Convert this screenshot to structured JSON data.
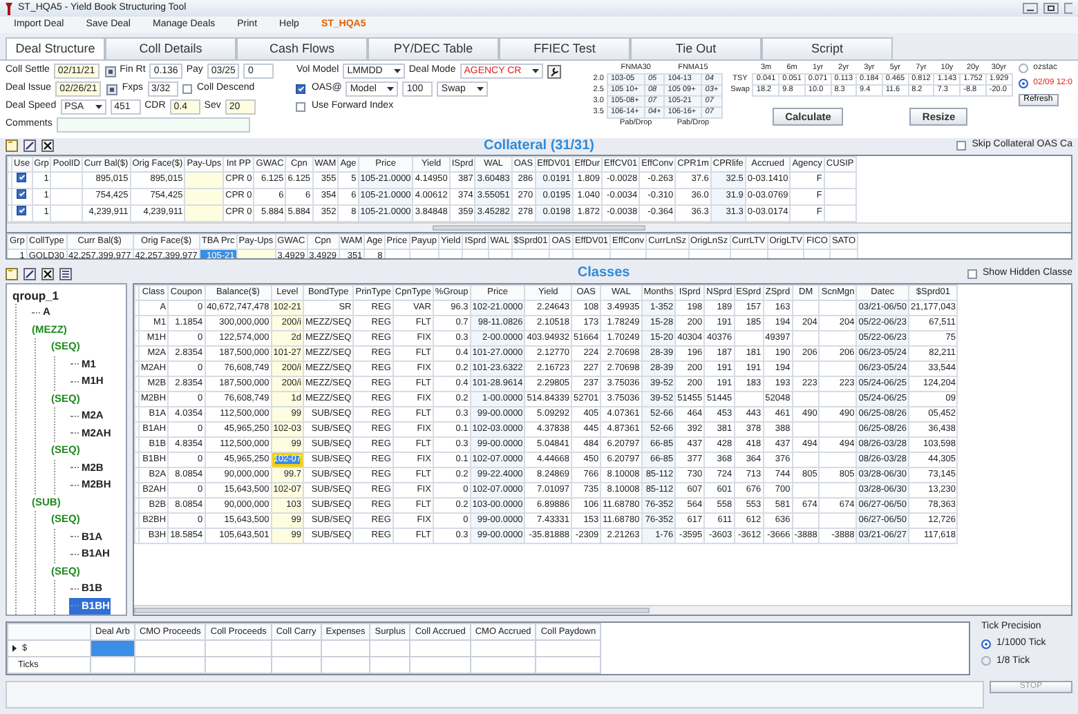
{
  "window": {
    "title": "ST_HQA5 - Yield Book Structuring Tool"
  },
  "menu": [
    {
      "label": "Import Deal",
      "kind": "item"
    },
    {
      "label": "Save Deal",
      "kind": "item"
    },
    {
      "label": "Manage Deals",
      "kind": "item"
    },
    {
      "label": "Print",
      "kind": "item"
    },
    {
      "label": "Help",
      "kind": "item"
    },
    {
      "label": "ST_HQA5",
      "kind": "deal"
    }
  ],
  "tabs": [
    {
      "label": "Deal Structure",
      "selected": true
    },
    {
      "label": "Coll Details",
      "selected": false
    },
    {
      "label": "Cash Flows",
      "selected": false
    },
    {
      "label": "PY/DEC Table",
      "selected": false
    },
    {
      "label": "FFIEC Test",
      "selected": false
    },
    {
      "label": "Tie Out",
      "selected": false
    },
    {
      "label": "Script",
      "selected": false
    }
  ],
  "form": {
    "left": [
      [
        {
          "kind": "label",
          "text": "Coll Settle"
        },
        {
          "kind": "date",
          "value": "02/11/21",
          "highlighted": true
        },
        {
          "kind": "label",
          "text": "Fin Rt"
        },
        {
          "kind": "input",
          "value": "0.136",
          "highlighted": false
        },
        {
          "kind": "label",
          "text": "Pay"
        },
        {
          "kind": "input",
          "value": "03/25",
          "highlighted": false
        },
        {
          "kind": "input",
          "value": "0",
          "highlighted": false
        }
      ],
      [
        {
          "kind": "label",
          "text": "Deal Issue"
        },
        {
          "kind": "date",
          "value": "02/26/21",
          "highlighted": true
        },
        {
          "kind": "label",
          "text": "Fxps"
        },
        {
          "kind": "input",
          "value": "3/32",
          "highlighted": false
        },
        {
          "kind": "checkbox",
          "label": "Coll Descend",
          "checked": false
        }
      ],
      [
        {
          "kind": "label",
          "text": "Deal Speed"
        },
        {
          "kind": "select",
          "value": "PSA"
        },
        {
          "kind": "input",
          "value": "451",
          "highlighted": false
        },
        {
          "kind": "label",
          "text": "CDR"
        },
        {
          "kind": "input",
          "value": "0.4",
          "highlighted": true
        },
        {
          "kind": "label",
          "text": "Sev"
        },
        {
          "kind": "input",
          "value": "20",
          "highlighted": true
        }
      ],
      [
        {
          "kind": "label",
          "text": "Comments"
        },
        {
          "kind": "wide"
        }
      ]
    ],
    "right": [
      [
        {
          "kind": "label",
          "text": "Vol Model"
        },
        {
          "kind": "select",
          "value": "LMMDD"
        },
        {
          "kind": "label",
          "text": "Deal Mode"
        },
        {
          "kind": "select",
          "value": "AGENCY CR",
          "color": "#e02020"
        },
        {
          "kind": "tool"
        }
      ],
      [
        {
          "kind": "checkbox",
          "label": "OAS@",
          "checked": true
        },
        {
          "kind": "select",
          "value": "Model"
        },
        {
          "kind": "input",
          "value": "100",
          "highlighted": false
        },
        {
          "kind": "select",
          "value": "Swap"
        }
      ],
      [
        {
          "kind": "checkbox",
          "label": "Use Forward Index",
          "checked": false
        }
      ]
    ]
  },
  "prices": {
    "columns": [
      "FNMA30",
      "FNMA15"
    ],
    "rows": [
      {
        "coupon": "2.0",
        "cells": [
          {
            "price": "103-05",
            "drop": "05"
          },
          {
            "price": "104-13",
            "drop": "04"
          }
        ]
      },
      {
        "coupon": "2.5",
        "cells": [
          {
            "price": "105 10+",
            "drop": "08"
          },
          {
            "price": "105 09+",
            "drop": "03+"
          }
        ]
      },
      {
        "coupon": "3.0",
        "cells": [
          {
            "price": "105-08+",
            "drop": "07"
          },
          {
            "price": "105-21",
            "drop": "07"
          }
        ]
      },
      {
        "coupon": "3.5",
        "cells": [
          {
            "price": "106-14+",
            "drop": "04+"
          },
          {
            "price": "106-16+",
            "drop": "07"
          }
        ]
      }
    ],
    "footer": [
      "Pab/Drop",
      "Pab/Drop"
    ]
  },
  "rates": {
    "columns": [
      "3m",
      "6m",
      "1yr",
      "2yr",
      "3yr",
      "5yr",
      "7yr",
      "10y",
      "20y",
      "30yr"
    ],
    "rows": [
      {
        "label": "TSY",
        "values": [
          "0.041",
          "0.051",
          "0.071",
          "0.113",
          "0.184",
          "0.465",
          "0.812",
          "1.143",
          "1.752",
          "1.929"
        ]
      },
      {
        "label": "Swap",
        "values": [
          "18.2",
          "9.8",
          "10.0",
          "8.3",
          "9.4",
          "11.6",
          "8.2",
          "7.3",
          "-8.8",
          "-20.0"
        ]
      }
    ]
  },
  "sources": [
    {
      "label": "ozstac",
      "selected": false,
      "color": "#333333"
    },
    {
      "label": "02/09 12:0",
      "selected": true,
      "color": "#e02020"
    }
  ],
  "buttons": {
    "refresh": "Refresh",
    "calculate": "Calculate",
    "resize": "Resize",
    "stop": "STOP"
  },
  "collateral": {
    "title": "Collateral (31/31)",
    "skip": {
      "label": "Skip Collateral OAS Ca",
      "checked": false
    },
    "use_label": "Use",
    "columns": [
      {
        "label": "Grp",
        "editable": false
      },
      {
        "label": "PoolID",
        "editable": false
      },
      {
        "label": "Curr Bal($)",
        "editable": false
      },
      {
        "label": "Orig Face($)",
        "editable": false
      },
      {
        "label": "Pay-Ups",
        "editable": true
      },
      {
        "label": "Int PP",
        "editable": false
      },
      {
        "label": "GWAC",
        "editable": false
      },
      {
        "label": "Cpn",
        "editable": false
      },
      {
        "label": "WAM",
        "editable": false
      },
      {
        "label": "Age",
        "editable": false
      },
      {
        "label": "Price",
        "editable": false
      },
      {
        "label": "Yield",
        "editable": false
      },
      {
        "label": "ISprd",
        "editable": false
      },
      {
        "label": "WAL",
        "editable": false
      },
      {
        "label": "OAS",
        "editable": false
      },
      {
        "label": "EffDV01",
        "editable": false
      },
      {
        "label": "EffDur",
        "editable": false
      },
      {
        "label": "EffCV01",
        "editable": false
      },
      {
        "label": "EffConv",
        "editable": false
      },
      {
        "label": "CPR1m",
        "editable": false
      },
      {
        "label": "CPRlife",
        "editable": false
      },
      {
        "label": "Accrued",
        "editable": false
      },
      {
        "label": "Agency",
        "editable": false
      },
      {
        "label": "CUSIP",
        "editable": false
      }
    ],
    "rows": [
      {
        "use": true,
        "cells": [
          "1",
          "",
          "895,015",
          "895,015",
          "",
          "CPR 0",
          "6.125",
          "6.125",
          "355",
          "5",
          "105-21.0000",
          "4.14950",
          "387",
          "3.60483",
          "286",
          "0.0191",
          "1.809",
          "-0.0028",
          "-0.263",
          "37.6",
          "32.5",
          "0-03.1410",
          "F",
          ""
        ]
      },
      {
        "use": true,
        "cells": [
          "1",
          "",
          "754,425",
          "754,425",
          "",
          "CPR 0",
          "6",
          "6",
          "354",
          "6",
          "105-21.0000",
          "4.00612",
          "374",
          "3.55051",
          "270",
          "0.0195",
          "1.040",
          "-0.0034",
          "-0.310",
          "36.0",
          "31.9",
          "0-03.0769",
          "F",
          ""
        ]
      },
      {
        "use": true,
        "cells": [
          "1",
          "",
          "4,239,911",
          "4,239,911",
          "",
          "CPR 0",
          "5.884",
          "5.884",
          "352",
          "8",
          "105-21.0000",
          "3.84848",
          "359",
          "3.45282",
          "278",
          "0.0198",
          "1.872",
          "-0.0038",
          "-0.364",
          "36.3",
          "31.3",
          "0-03.0174",
          "F",
          ""
        ]
      }
    ]
  },
  "summary": {
    "columns": [
      {
        "label": "Grp",
        "editable": false
      },
      {
        "label": "CollType",
        "editable": false
      },
      {
        "label": "Curr Bal($)",
        "editable": false
      },
      {
        "label": "Orig Face($)",
        "editable": false
      },
      {
        "label": "TBA Prc",
        "editable": false
      },
      {
        "label": "Pay-Ups",
        "editable": true
      },
      {
        "label": "GWAC",
        "editable": false
      },
      {
        "label": "Cpn",
        "editable": false
      },
      {
        "label": "WAM",
        "editable": false
      },
      {
        "label": "Age",
        "editable": false
      },
      {
        "label": "Price",
        "editable": false
      },
      {
        "label": "Payup",
        "editable": false
      },
      {
        "label": "Yield",
        "editable": false
      },
      {
        "label": "ISprd",
        "editable": false
      },
      {
        "label": "WAL",
        "editable": false
      },
      {
        "label": "$Sprd01",
        "editable": false
      },
      {
        "label": "OAS",
        "editable": false
      },
      {
        "label": "EffDV01",
        "editable": false
      },
      {
        "label": "EffConv",
        "editable": false
      },
      {
        "label": "CurrLnSz",
        "editable": false
      },
      {
        "label": "OrigLnSz",
        "editable": false
      },
      {
        "label": "CurrLTV",
        "editable": false
      },
      {
        "label": "OrigLTV",
        "editable": false
      },
      {
        "label": "FICO",
        "editable": false
      },
      {
        "label": "SATO",
        "editable": false
      }
    ],
    "rows": [
      {
        "selected": true,
        "cells": [
          "1",
          "GOLD30",
          "42,257,399,977",
          "42,257,399,977",
          "105-21",
          "",
          "3.4929",
          "3.4929",
          "351",
          "8",
          "",
          "",
          "",
          "",
          "",
          "",
          "",
          "",
          "",
          "",
          "",
          "",
          "",
          "",
          ""
        ]
      }
    ]
  },
  "classes": {
    "title": "Classes",
    "show_hidden": {
      "label": "Show Hidden Classe",
      "checked": false
    },
    "tree": {
      "label": "qroup_1",
      "kind": "root",
      "children": [
        {
          "label": "A",
          "kind": "class"
        },
        {
          "label": "(MEZZ)",
          "kind": "group",
          "children": [
            {
              "label": "(SEQ)",
              "kind": "group",
              "children": [
                {
                  "label": "M1",
                  "kind": "class"
                },
                {
                  "label": "M1H",
                  "kind": "class"
                }
              ]
            },
            {
              "label": "(SEQ)",
              "kind": "group",
              "children": [
                {
                  "label": "M2A",
                  "kind": "class"
                },
                {
                  "label": "M2AH",
                  "kind": "class"
                }
              ]
            },
            {
              "label": "(SEQ)",
              "kind": "group",
              "children": [
                {
                  "label": "M2B",
                  "kind": "class"
                },
                {
                  "label": "M2BH",
                  "kind": "class"
                }
              ]
            }
          ]
        },
        {
          "label": "(SUB)",
          "kind": "group",
          "children": [
            {
              "label": "(SEQ)",
              "kind": "group",
              "children": [
                {
                  "label": "B1A",
                  "kind": "class"
                },
                {
                  "label": "B1AH",
                  "kind": "class"
                }
              ]
            },
            {
              "label": "(SEQ)",
              "kind": "group",
              "children": [
                {
                  "label": "B1B",
                  "kind": "class"
                },
                {
                  "label": "B1BH",
                  "kind": "class",
                  "selected": true
                }
              ]
            }
          ]
        }
      ]
    },
    "columns": [
      {
        "label": "Class",
        "editable": false
      },
      {
        "label": "Coupon",
        "editable": false
      },
      {
        "label": "Balance($)",
        "editable": false
      },
      {
        "label": "Level",
        "editable": true
      },
      {
        "label": "BondType",
        "editable": false
      },
      {
        "label": "PrinType",
        "editable": false
      },
      {
        "label": "CpnType",
        "editable": false
      },
      {
        "label": "%Group",
        "editable": false
      },
      {
        "label": "Price",
        "editable": false
      },
      {
        "label": "Yield",
        "editable": false
      },
      {
        "label": "OAS",
        "editable": false
      },
      {
        "label": "WAL",
        "editable": false
      },
      {
        "label": "Months",
        "editable": false
      },
      {
        "label": "ISprd",
        "editable": false
      },
      {
        "label": "NSprd",
        "editable": false
      },
      {
        "label": "ESprd",
        "editable": false
      },
      {
        "label": "ZSprd",
        "editable": false
      },
      {
        "label": "DM",
        "editable": false
      },
      {
        "label": "ScnMgn",
        "editable": false
      },
      {
        "label": "Datec",
        "editable": false
      },
      {
        "label": "$Sprd01",
        "editable": false
      }
    ],
    "rows": [
      {
        "selected": false,
        "cells": [
          "A",
          "0",
          "40,672,747,478",
          "102-21",
          "SR",
          "REG",
          "VAR",
          "96.3",
          "102-21.0000",
          "2.24643",
          "108",
          "3.49935",
          "1-352",
          "198",
          "189",
          "157",
          "163",
          "",
          "",
          "03/21-06/50",
          "21,177,043"
        ]
      },
      {
        "selected": false,
        "cells": [
          "M1",
          "1.1854",
          "300,000,000",
          "200/i",
          "MEZZ/SEQ",
          "REG",
          "FLT",
          "0.7",
          "98-11.0826",
          "2.10518",
          "173",
          "1.78249",
          "15-28",
          "200",
          "191",
          "185",
          "194",
          "204",
          "204",
          "05/22-06/23",
          "67,511"
        ]
      },
      {
        "selected": false,
        "cells": [
          "M1H",
          "0",
          "122,574,000",
          "2d",
          "MEZZ/SEQ",
          "REG",
          "FIX",
          "0.3",
          "2-00.0000",
          "403.94932",
          "51664",
          "1.70249",
          "15-20",
          "40304",
          "40376",
          "",
          "49397",
          "",
          "",
          "05/22-06/23",
          "75"
        ]
      },
      {
        "selected": false,
        "cells": [
          "M2A",
          "2.8354",
          "187,500,000",
          "101-27",
          "MEZZ/SEQ",
          "REG",
          "FLT",
          "0.4",
          "101-27.0000",
          "2.12770",
          "224",
          "2.70698",
          "28-39",
          "196",
          "187",
          "181",
          "190",
          "206",
          "206",
          "06/23-05/24",
          "82,211"
        ]
      },
      {
        "selected": false,
        "cells": [
          "M2AH",
          "0",
          "76,608,749",
          "200/i",
          "MEZZ/SEQ",
          "REG",
          "FIX",
          "0.2",
          "101-23.6322",
          "2.16723",
          "227",
          "2.70698",
          "28-39",
          "200",
          "191",
          "191",
          "194",
          "",
          "",
          "06/23-05/24",
          "33,544"
        ]
      },
      {
        "selected": false,
        "cells": [
          "M2B",
          "2.8354",
          "187,500,000",
          "200/i",
          "MEZZ/SEQ",
          "REG",
          "FLT",
          "0.4",
          "101-28.9614",
          "2.29805",
          "237",
          "3.75036",
          "39-52",
          "200",
          "191",
          "183",
          "193",
          "223",
          "223",
          "05/24-06/25",
          "124,204"
        ]
      },
      {
        "selected": false,
        "cells": [
          "M2BH",
          "0",
          "76,608,749",
          "1d",
          "MEZZ/SEQ",
          "REG",
          "FIX",
          "0.2",
          "1-00.0000",
          "514.84339",
          "52701",
          "3.75036",
          "39-52",
          "51455",
          "51445",
          "",
          "52048",
          "",
          "",
          "05/24-06/25",
          "09"
        ]
      },
      {
        "selected": false,
        "cells": [
          "B1A",
          "4.0354",
          "112,500,000",
          "99",
          "SUB/SEQ",
          "REG",
          "FLT",
          "0.3",
          "99-00.0000",
          "5.09292",
          "405",
          "4.07361",
          "52-66",
          "464",
          "453",
          "443",
          "461",
          "490",
          "490",
          "06/25-08/26",
          "05,452"
        ]
      },
      {
        "selected": false,
        "cells": [
          "B1AH",
          "0",
          "45,965,250",
          "102-03",
          "SUB/SEQ",
          "REG",
          "FIX",
          "0.1",
          "102-03.0000",
          "4.37838",
          "445",
          "4.87361",
          "52-66",
          "392",
          "381",
          "378",
          "388",
          "",
          "",
          "06/25-08/26",
          "36,438"
        ]
      },
      {
        "selected": false,
        "cells": [
          "B1B",
          "4.8354",
          "112,500,000",
          "99",
          "SUB/SEQ",
          "REG",
          "FLT",
          "0.3",
          "99-00.0000",
          "5.04841",
          "484",
          "6.20797",
          "66-85",
          "437",
          "428",
          "418",
          "437",
          "494",
          "494",
          "08/26-03/28",
          "103,598"
        ]
      },
      {
        "selected": true,
        "cells": [
          "B1BH",
          "0",
          "45,965,250",
          "102-07",
          "SUB/SEQ",
          "REG",
          "FIX",
          "0.1",
          "102-07.0000",
          "4.44668",
          "450",
          "6.20797",
          "66-85",
          "377",
          "368",
          "364",
          "376",
          "",
          "",
          "08/26-03/28",
          "44,305"
        ]
      },
      {
        "selected": false,
        "cells": [
          "B2A",
          "8.0854",
          "90,000,000",
          "99.7",
          "SUB/SEQ",
          "REG",
          "FLT",
          "0.2",
          "99-22.4000",
          "8.24869",
          "766",
          "8.10008",
          "85-112",
          "730",
          "724",
          "713",
          "744",
          "805",
          "805",
          "03/28-06/30",
          "73,145"
        ]
      },
      {
        "selected": false,
        "cells": [
          "B2AH",
          "0",
          "15,643,500",
          "102-07",
          "SUB/SEQ",
          "REG",
          "FIX",
          "0",
          "102-07.0000",
          "7.01097",
          "735",
          "8.10008",
          "85-112",
          "607",
          "601",
          "676",
          "700",
          "",
          "",
          "03/28-06/30",
          "13,230"
        ]
      },
      {
        "selected": false,
        "cells": [
          "B2B",
          "8.0854",
          "90,000,000",
          "103",
          "SUB/SEQ",
          "REG",
          "FLT",
          "0.2",
          "103-00.0000",
          "6.89886",
          "106",
          "11.68780",
          "76-352",
          "564",
          "558",
          "553",
          "581",
          "674",
          "674",
          "06/27-06/50",
          "78,363"
        ]
      },
      {
        "selected": false,
        "cells": [
          "B2BH",
          "0",
          "15,643,500",
          "99",
          "SUB/SEQ",
          "REG",
          "FIX",
          "0",
          "99-00.0000",
          "7.43331",
          "153",
          "11.68780",
          "76-352",
          "617",
          "611",
          "612",
          "636",
          "",
          "",
          "06/27-06/50",
          "12,726"
        ]
      },
      {
        "selected": false,
        "cells": [
          "B3H",
          "18.5854",
          "105,643,501",
          "99",
          "SUB/SEQ",
          "REG",
          "FLT",
          "0.3",
          "99-00.0000",
          "-35.81888",
          "-2309",
          "2.21263",
          "1-76",
          "-3595",
          "-3603",
          "-3612",
          "-3666",
          "-3888",
          "-3888",
          "03/21-06/27",
          "117,618"
        ]
      }
    ]
  },
  "results": {
    "columns": [
      "Deal Arb",
      "CMO Proceeds",
      "Coll Proceeds",
      "Coll Carry",
      "Expenses",
      "Surplus",
      "Coll Accrued",
      "CMO Accrued",
      "Coll Paydown"
    ],
    "rows": [
      {
        "label": "$",
        "current": true
      },
      {
        "label": "Ticks",
        "current": false
      }
    ]
  },
  "tick_precision": {
    "title": "Tick Precision",
    "options": [
      {
        "label": "1/1000 Tick",
        "selected": true
      },
      {
        "label": "1/8 Tick",
        "selected": false
      }
    ]
  }
}
